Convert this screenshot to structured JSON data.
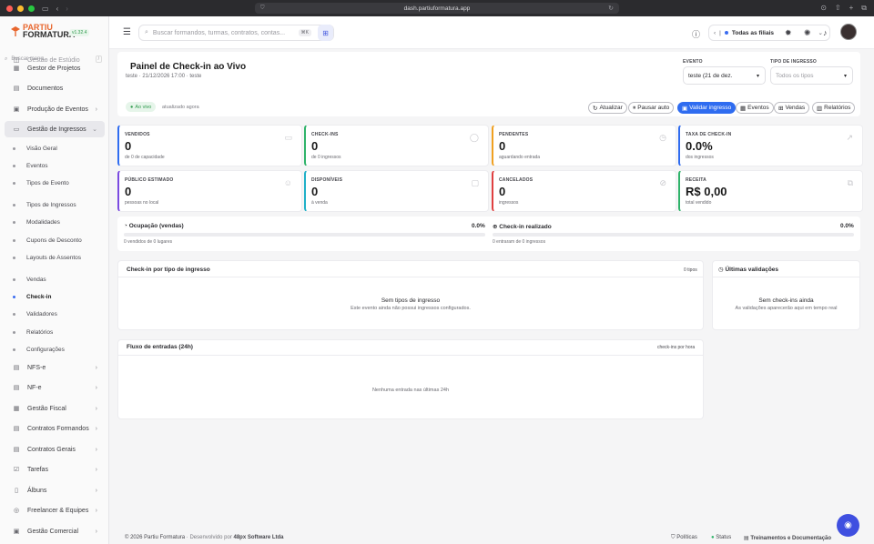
{
  "browser": {
    "url": "dash.partiuformatura.app"
  },
  "brand": {
    "logo_top": "PARTIU",
    "logo_bottom": "FORMATURA",
    "version": "v1.32.4"
  },
  "sidebar": {
    "search_placeholder": "Buscar menu...",
    "search_key": "/",
    "partial_top_item": "Gestão de Estúdio",
    "items": [
      {
        "label": "Gestor de Projetos",
        "icon": "kanban-icon"
      },
      {
        "label": "Documentos",
        "icon": "document-icon"
      },
      {
        "label": "Produção de Eventos",
        "icon": "calendar-icon"
      },
      {
        "label": "Gestão de Ingressos",
        "icon": "ticket-icon"
      }
    ],
    "sub_items": [
      "Visão Geral",
      "Eventos",
      "Tipos de Evento",
      "Tipos de Ingressos",
      "Modalidades",
      "Cupons de Desconto",
      "Layouts de Assentos",
      "Vendas",
      "Check-in",
      "Validadores",
      "Relatórios",
      "Configurações"
    ],
    "bottom_items": [
      "NFS-e",
      "NF-e",
      "Gestão Fiscal",
      "Contratos Formandos",
      "Contratos Gerais",
      "Tarefas",
      "Álbuns",
      "Freelancer & Equipes",
      "Gestão Comercial"
    ]
  },
  "topbar": {
    "search_placeholder": "Buscar formandos, turmas, contratos, contas...",
    "search_kbd": "⌘K",
    "branch_label": "Todas as filiais"
  },
  "header": {
    "title": "Painel de Check-in ao Vivo",
    "subtitle": "teste · 21/12/2026 17:00 · teste",
    "event_label": "EVENTO",
    "event_value": "teste (21 de dez.",
    "ticket_type_label": "TIPO DE INGRESSO",
    "ticket_type_value": "Todos os tipos"
  },
  "toolbar": {
    "live": "Ao vivo",
    "updated": "atualizado agora",
    "refresh": "Atualizar",
    "pause": "Pausar auto",
    "validate": "Validar ingresso",
    "events": "Eventos",
    "sales": "Vendas",
    "reports": "Relatórios"
  },
  "stats": [
    {
      "label": "VENDIDOS",
      "value": "0",
      "sub": "de 0 de capacidade",
      "color": "#2f6cf0"
    },
    {
      "label": "CHECK-INS",
      "value": "0",
      "sub": "de 0 ingressos",
      "color": "#2fb36a"
    },
    {
      "label": "PENDENTES",
      "value": "0",
      "sub": "aguardando entrada",
      "color": "#f0a020"
    },
    {
      "label": "TAXA DE CHECK-IN",
      "value": "0.0%",
      "sub": "dos ingressos",
      "color": "#2f6cf0"
    },
    {
      "label": "PÚBLICO ESTIMADO",
      "value": "0",
      "sub": "pessoas no local",
      "color": "#7a4ae0"
    },
    {
      "label": "DISPONÍVEIS",
      "value": "0",
      "sub": "à venda",
      "color": "#20b0c8"
    },
    {
      "label": "CANCELADOS",
      "value": "0",
      "sub": "ingressos",
      "color": "#e04040"
    },
    {
      "label": "RECEITA",
      "value": "R$ 0,00",
      "sub": "total vendido",
      "color": "#2fb36a"
    }
  ],
  "progress": {
    "occupancy_label": "Ocupação (vendas)",
    "occupancy_pct": "0.0%",
    "occupancy_fraction": 0,
    "occupancy_sub": "0 vendidos de 0 lugares",
    "checkin_label": "Check-in realizado",
    "checkin_pct": "0.0%",
    "checkin_fraction": 0,
    "checkin_sub": "0 entraram de 0 ingressos"
  },
  "by_type": {
    "title": "Check-in por tipo de ingresso",
    "count": "0 tipos",
    "empty_title": "Sem tipos de ingresso",
    "empty_sub": "Este evento ainda não possui ingressos configurados."
  },
  "last_validations": {
    "title": "Últimas validações",
    "empty_title": "Sem check-ins ainda",
    "empty_sub": "As validações aparecerão aqui em tempo real"
  },
  "flow": {
    "title": "Fluxo de entradas (24h)",
    "meta": "check-ins por hora",
    "empty": "Nenhuma entrada nas últimas 24h"
  },
  "footer": {
    "copyright": "© 2026 Partiu Formatura",
    "dev_prefix": "· Desenvolvido por",
    "dev_name": "48px Software Ltda",
    "policies": "Políticas",
    "status": "Status",
    "docs": "Treinamentos e Documentação"
  }
}
